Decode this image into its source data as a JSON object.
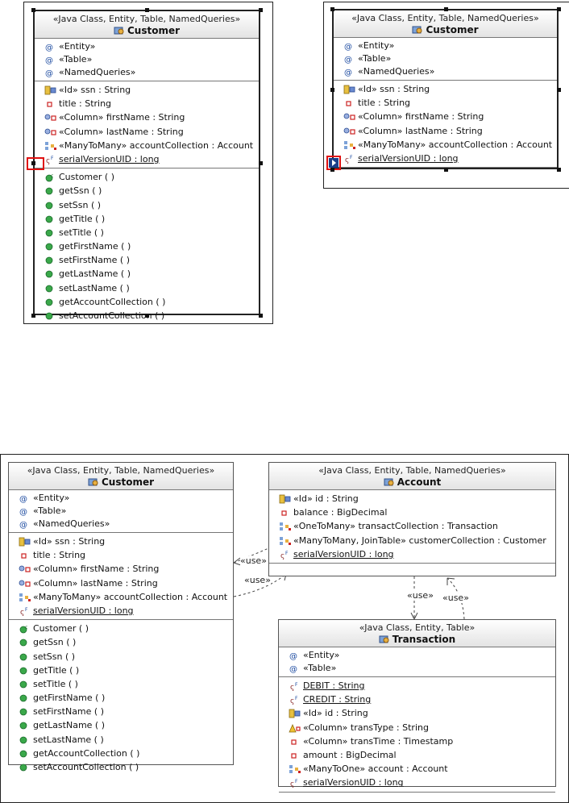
{
  "stereo_cet": "«Java Class, Entity, Table, NamedQueries»",
  "stereo_ce": "«Java Class, Entity, Table»",
  "customer": {
    "name": "Customer",
    "annotations": [
      "«Entity»",
      "«Table»",
      "«NamedQueries»"
    ],
    "attributes": [
      {
        "pre": "«Id» ssn : String",
        "icon": "id-key-icon"
      },
      {
        "pre": "title : String",
        "icon": "field-icon"
      },
      {
        "pre": "«Column» firstName : String",
        "icon": "column-field-icon"
      },
      {
        "pre": "«Column» lastName : String",
        "icon": "column-field-icon"
      },
      {
        "pre": "«ManyToMany» accountCollection : Account",
        "icon": "relation-icon"
      },
      {
        "pre": "serialVersionUID : long",
        "icon": "static-final-icon",
        "underline": true
      }
    ],
    "operations": [
      "Customer ( )",
      "getSsn ( )",
      "setSsn ( )",
      "getTitle ( )",
      "setTitle ( )",
      "getFirstName ( )",
      "setFirstName ( )",
      "getLastName ( )",
      "setLastName ( )",
      "getAccountCollection ( )",
      "setAccountCollection ( )"
    ]
  },
  "account": {
    "name": "Account",
    "attributes": [
      {
        "pre": "«Id» id : String",
        "icon": "id-key-icon"
      },
      {
        "pre": "balance : BigDecimal",
        "icon": "field-icon"
      },
      {
        "pre": "«OneToMany» transactCollection : Transaction",
        "icon": "relation-icon"
      },
      {
        "pre": "«ManyToMany, JoinTable» customerCollection : Customer",
        "icon": "relation-icon"
      },
      {
        "pre": "serialVersionUID : long",
        "icon": "static-final-icon",
        "underline": true
      }
    ]
  },
  "transaction": {
    "name": "Transaction",
    "annotations": [
      "«Entity»",
      "«Table»"
    ],
    "attributes": [
      {
        "pre": "DEBIT : String",
        "icon": "static-final-icon",
        "underline": true
      },
      {
        "pre": "CREDIT : String",
        "icon": "static-final-icon",
        "underline": true
      },
      {
        "pre": "«Id» id : String",
        "icon": "id-key-icon"
      },
      {
        "pre": "«Column» transType : String",
        "icon": "warning-field-icon"
      },
      {
        "pre": "«Column» transTime : Timestamp",
        "icon": "field-icon"
      },
      {
        "pre": "amount : BigDecimal",
        "icon": "field-icon"
      },
      {
        "pre": "«ManyToOne» account : Account",
        "icon": "relation-icon"
      },
      {
        "pre": "serialVersionUID : long",
        "icon": "static-final-icon",
        "underline": true
      }
    ]
  },
  "use_label": "«use»"
}
